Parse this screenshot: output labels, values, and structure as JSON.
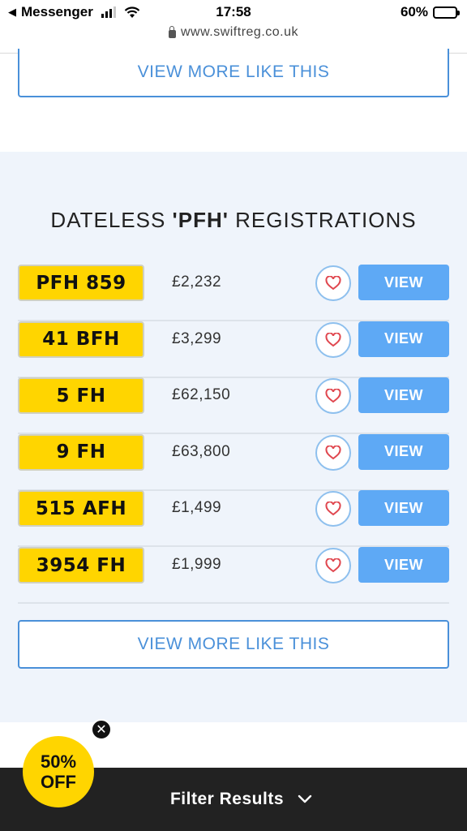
{
  "status_bar": {
    "back_app": "Messenger",
    "time": "17:58",
    "battery": "60%",
    "battery_level": 0.6
  },
  "browser": {
    "url": "www.swiftreg.co.uk"
  },
  "top_button": {
    "label": "VIEW MORE LIKE THIS"
  },
  "section": {
    "title_prefix": "DATELESS ",
    "title_highlight": "'PFH'",
    "title_suffix": " REGISTRATIONS",
    "rows": [
      {
        "plate": "PFH 859",
        "price": "£2,232",
        "view_label": "VIEW"
      },
      {
        "plate": "41 BFH",
        "price": "£3,299",
        "view_label": "VIEW"
      },
      {
        "plate": "5 FH",
        "price": "£62,150",
        "view_label": "VIEW"
      },
      {
        "plate": "9 FH",
        "price": "£63,800",
        "view_label": "VIEW"
      },
      {
        "plate": "515 AFH",
        "price": "£1,499",
        "view_label": "VIEW"
      },
      {
        "plate": "3954 FH",
        "price": "£1,999",
        "view_label": "VIEW"
      }
    ],
    "bottom_button": {
      "label": "VIEW MORE LIKE THIS"
    }
  },
  "promo": {
    "line1": "50%",
    "line2": "OFF",
    "close_symbol": "✕"
  },
  "filter_bar": {
    "label": "Filter Results"
  },
  "colors": {
    "accent_blue": "#4a90d9",
    "view_button": "#5ea9f5",
    "plate_yellow": "#ffd500",
    "section_bg": "#eff4fb",
    "heart_red": "#e0474f",
    "bar_dark": "#222222"
  },
  "icons": [
    "back-arrow-icon",
    "signal-icon",
    "wifi-icon",
    "battery-icon",
    "lock-icon",
    "heart-icon",
    "close-icon",
    "chevron-down-icon"
  ]
}
